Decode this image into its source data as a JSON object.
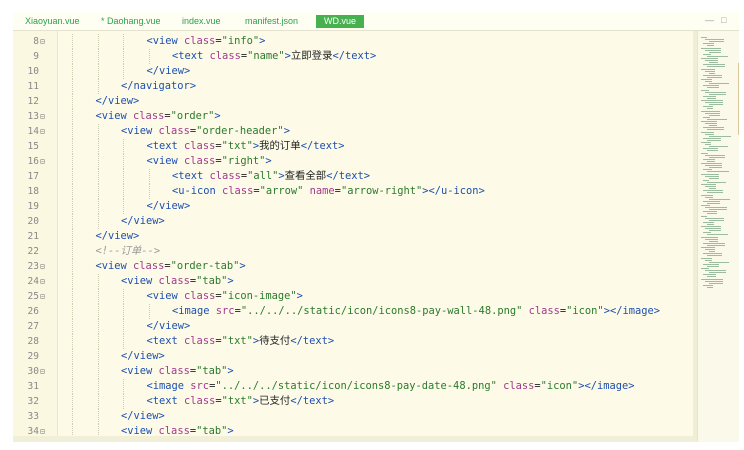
{
  "tabs": [
    {
      "label": "Xiaoyuan.vue",
      "active": false
    },
    {
      "label": "* Daohang.vue",
      "active": false
    },
    {
      "label": "index.vue",
      "active": false
    },
    {
      "label": "manifest.json",
      "active": false
    },
    {
      "label": "WD.vue",
      "active": true
    }
  ],
  "window_controls": {
    "minimize": "—",
    "restore": "□"
  },
  "colors": {
    "tag": "#1d4fae",
    "attr": "#a03a8a",
    "string": "#2b7a2b",
    "comment": "#9a9a9a",
    "text": "#222222",
    "active_tab": "#47b04f",
    "tab_text": "#2aa24a",
    "background": "#fdfbe8"
  },
  "code_lines": [
    {
      "num": "8",
      "fold": true,
      "indent": 3,
      "tokens": [
        [
          "t",
          "<view "
        ],
        [
          "a",
          "class"
        ],
        [
          "x",
          "="
        ],
        [
          "s",
          "\"info\""
        ],
        [
          "t",
          ">"
        ]
      ]
    },
    {
      "num": "9",
      "fold": false,
      "indent": 4,
      "tokens": [
        [
          "t",
          "<text "
        ],
        [
          "a",
          "class"
        ],
        [
          "x",
          "="
        ],
        [
          "s",
          "\"name\""
        ],
        [
          "t",
          ">"
        ],
        [
          "x",
          "立即登录"
        ],
        [
          "t",
          "</text>"
        ]
      ]
    },
    {
      "num": "10",
      "fold": false,
      "indent": 3,
      "tokens": [
        [
          "t",
          "</view>"
        ]
      ]
    },
    {
      "num": "11",
      "fold": false,
      "indent": 2,
      "tokens": [
        [
          "t",
          "</navigator>"
        ]
      ]
    },
    {
      "num": "12",
      "fold": false,
      "indent": 1,
      "tokens": [
        [
          "t",
          "</view>"
        ]
      ]
    },
    {
      "num": "13",
      "fold": true,
      "indent": 1,
      "tokens": [
        [
          "t",
          "<view "
        ],
        [
          "a",
          "class"
        ],
        [
          "x",
          "="
        ],
        [
          "s",
          "\"order\""
        ],
        [
          "t",
          ">"
        ]
      ]
    },
    {
      "num": "14",
      "fold": true,
      "indent": 2,
      "tokens": [
        [
          "t",
          "<view "
        ],
        [
          "a",
          "class"
        ],
        [
          "x",
          "="
        ],
        [
          "s",
          "\"order-header\""
        ],
        [
          "t",
          ">"
        ]
      ]
    },
    {
      "num": "15",
      "fold": false,
      "indent": 3,
      "tokens": [
        [
          "t",
          "<text "
        ],
        [
          "a",
          "class"
        ],
        [
          "x",
          "="
        ],
        [
          "s",
          "\"txt\""
        ],
        [
          "t",
          ">"
        ],
        [
          "x",
          "我的订单"
        ],
        [
          "t",
          "</text>"
        ]
      ]
    },
    {
      "num": "16",
      "fold": true,
      "indent": 3,
      "tokens": [
        [
          "t",
          "<view "
        ],
        [
          "a",
          "class"
        ],
        [
          "x",
          "="
        ],
        [
          "s",
          "\"right\""
        ],
        [
          "t",
          ">"
        ]
      ]
    },
    {
      "num": "17",
      "fold": false,
      "indent": 4,
      "tokens": [
        [
          "t",
          "<text "
        ],
        [
          "a",
          "class"
        ],
        [
          "x",
          "="
        ],
        [
          "s",
          "\"all\""
        ],
        [
          "t",
          ">"
        ],
        [
          "x",
          "查看全部"
        ],
        [
          "t",
          "</text>"
        ]
      ]
    },
    {
      "num": "18",
      "fold": false,
      "indent": 4,
      "tokens": [
        [
          "t",
          "<u-icon "
        ],
        [
          "a",
          "class"
        ],
        [
          "x",
          "="
        ],
        [
          "s",
          "\"arrow\" "
        ],
        [
          "a",
          "name"
        ],
        [
          "x",
          "="
        ],
        [
          "s",
          "\"arrow-right\""
        ],
        [
          "t",
          "></u-icon>"
        ]
      ]
    },
    {
      "num": "19",
      "fold": false,
      "indent": 3,
      "tokens": [
        [
          "t",
          "</view>"
        ]
      ]
    },
    {
      "num": "20",
      "fold": false,
      "indent": 2,
      "tokens": [
        [
          "t",
          "</view>"
        ]
      ]
    },
    {
      "num": "21",
      "fold": false,
      "indent": 1,
      "tokens": [
        [
          "t",
          "</view>"
        ]
      ]
    },
    {
      "num": "22",
      "fold": false,
      "indent": 1,
      "tokens": [
        [
          "c",
          "<!--订单-->"
        ]
      ]
    },
    {
      "num": "23",
      "fold": true,
      "indent": 1,
      "tokens": [
        [
          "t",
          "<view "
        ],
        [
          "a",
          "class"
        ],
        [
          "x",
          "="
        ],
        [
          "s",
          "\"order-tab\""
        ],
        [
          "t",
          ">"
        ]
      ]
    },
    {
      "num": "24",
      "fold": true,
      "indent": 2,
      "tokens": [
        [
          "t",
          "<view "
        ],
        [
          "a",
          "class"
        ],
        [
          "x",
          "="
        ],
        [
          "s",
          "\"tab\""
        ],
        [
          "t",
          ">"
        ]
      ]
    },
    {
      "num": "25",
      "fold": true,
      "indent": 3,
      "tokens": [
        [
          "t",
          "<view "
        ],
        [
          "a",
          "class"
        ],
        [
          "x",
          "="
        ],
        [
          "s",
          "\"icon-image\""
        ],
        [
          "t",
          ">"
        ]
      ]
    },
    {
      "num": "26",
      "fold": false,
      "indent": 4,
      "tokens": [
        [
          "t",
          "<image "
        ],
        [
          "a",
          "src"
        ],
        [
          "x",
          "="
        ],
        [
          "s",
          "\"../../../static/icon/icons8-pay-wall-48.png\" "
        ],
        [
          "a",
          "class"
        ],
        [
          "x",
          "="
        ],
        [
          "s",
          "\"icon\""
        ],
        [
          "t",
          "></image>"
        ]
      ]
    },
    {
      "num": "27",
      "fold": false,
      "indent": 3,
      "tokens": [
        [
          "t",
          "</view>"
        ]
      ]
    },
    {
      "num": "28",
      "fold": false,
      "indent": 3,
      "tokens": [
        [
          "t",
          "<text "
        ],
        [
          "a",
          "class"
        ],
        [
          "x",
          "="
        ],
        [
          "s",
          "\"txt\""
        ],
        [
          "t",
          ">"
        ],
        [
          "x",
          "待支付"
        ],
        [
          "t",
          "</text>"
        ]
      ]
    },
    {
      "num": "29",
      "fold": false,
      "indent": 2,
      "tokens": [
        [
          "t",
          "</view>"
        ]
      ]
    },
    {
      "num": "30",
      "fold": true,
      "indent": 2,
      "tokens": [
        [
          "t",
          "<view "
        ],
        [
          "a",
          "class"
        ],
        [
          "x",
          "="
        ],
        [
          "s",
          "\"tab\""
        ],
        [
          "t",
          ">"
        ]
      ]
    },
    {
      "num": "31",
      "fold": false,
      "indent": 3,
      "tokens": [
        [
          "t",
          "<image "
        ],
        [
          "a",
          "src"
        ],
        [
          "x",
          "="
        ],
        [
          "s",
          "\"../../../static/icon/icons8-pay-date-48.png\" "
        ],
        [
          "a",
          "class"
        ],
        [
          "x",
          "="
        ],
        [
          "s",
          "\"icon\""
        ],
        [
          "t",
          "></image>"
        ]
      ]
    },
    {
      "num": "32",
      "fold": false,
      "indent": 3,
      "tokens": [
        [
          "t",
          "<text "
        ],
        [
          "a",
          "class"
        ],
        [
          "x",
          "="
        ],
        [
          "s",
          "\"txt\""
        ],
        [
          "t",
          ">"
        ],
        [
          "x",
          "已支付"
        ],
        [
          "t",
          "</text>"
        ]
      ]
    },
    {
      "num": "33",
      "fold": false,
      "indent": 2,
      "tokens": [
        [
          "t",
          "</view>"
        ]
      ]
    },
    {
      "num": "34",
      "fold": true,
      "indent": 2,
      "tokens": [
        [
          "t",
          "<view "
        ],
        [
          "a",
          "class"
        ],
        [
          "x",
          "="
        ],
        [
          "s",
          "\"tab\""
        ],
        [
          "t",
          ">"
        ]
      ]
    }
  ]
}
